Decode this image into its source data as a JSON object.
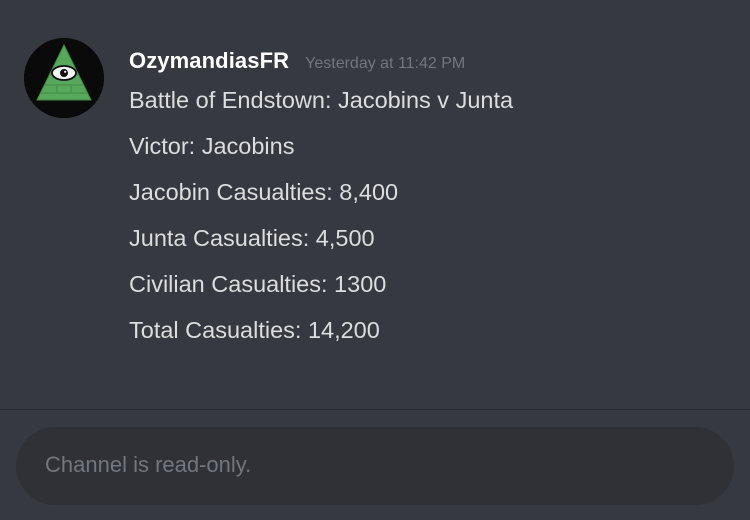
{
  "message": {
    "author": "OzymandiasFR",
    "timestamp": "Yesterday at 11:42 PM",
    "lines": [
      "Battle of Endstown: Jacobins v Junta",
      "Victor: Jacobins",
      "Jacobin Casualties: 8,400",
      "Junta Casualties: 4,500",
      "Civilian Casualties: 1300",
      "Total Casualties: 14,200"
    ]
  },
  "composer": {
    "placeholder": "Channel is read-only."
  },
  "avatar": {
    "icon": "all-seeing-eye-pyramid-icon"
  },
  "colors": {
    "background": "#36393f",
    "username": "#ffffff",
    "timestamp": "#72767d",
    "message_text": "#dcddde",
    "composer_bg": "#2f3136",
    "pyramid_green": "#4caf50"
  }
}
